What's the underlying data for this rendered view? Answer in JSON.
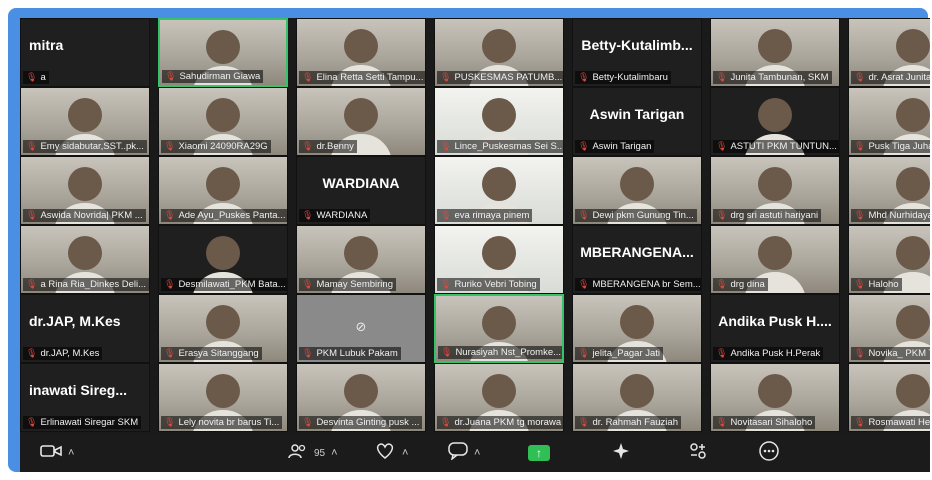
{
  "participants": [
    {
      "display": "mitra",
      "label": "a",
      "kind": "name"
    },
    {
      "display": "",
      "label": "Sahudirman Giawa",
      "kind": "video",
      "active": true
    },
    {
      "display": "",
      "label": "Elina Retta Setti Tampu...",
      "kind": "video"
    },
    {
      "display": "",
      "label": "PUSKESMAS PATUMB...",
      "kind": "video"
    },
    {
      "display": "Betty-Kutalimb...",
      "label": "Betty-Kutalimbaru",
      "kind": "name"
    },
    {
      "display": "",
      "label": "Junita Tambunan, SKM",
      "kind": "video"
    },
    {
      "display": "",
      "label": "dr. Asrat Junita pu",
      "kind": "video"
    },
    {
      "display": "",
      "label": "Emy sidabutar,SST..pk...",
      "kind": "video"
    },
    {
      "display": "",
      "label": "Xiaomi 24090RA29G",
      "kind": "video"
    },
    {
      "display": "",
      "label": "dr.Benny",
      "kind": "video"
    },
    {
      "display": "",
      "label": "Lince_Puskesmas Sei S...",
      "kind": "doc"
    },
    {
      "display": "Aswin Tarigan",
      "label": "Aswin Tarigan",
      "kind": "name"
    },
    {
      "display": "",
      "label": "ASTUTI PKM TUNTUN...",
      "kind": "dark"
    },
    {
      "display": "",
      "label": "Pusk Tiga Juhar_Ti",
      "kind": "video"
    },
    {
      "display": "",
      "label": "Aswida Novrida| PKM ...",
      "kind": "video"
    },
    {
      "display": "",
      "label": "Ade Ayu_Puskes Panta...",
      "kind": "video"
    },
    {
      "display": "WARDIANA",
      "label": "WARDIANA",
      "kind": "name"
    },
    {
      "display": "",
      "label": "eva rimaya pinem",
      "kind": "doc"
    },
    {
      "display": "",
      "label": "Dewi pkm Gunung Tin...",
      "kind": "video"
    },
    {
      "display": "",
      "label": "drg sri astuti hariyani",
      "kind": "video"
    },
    {
      "display": "",
      "label": "Mhd Nurhidayat",
      "kind": "video"
    },
    {
      "display": "",
      "label": "a Rina Ria_Dinkes Deli...",
      "kind": "video"
    },
    {
      "display": "",
      "label": "Desmilawati_PKM Bata...",
      "kind": "dark"
    },
    {
      "display": "",
      "label": "Mamay Sembiring",
      "kind": "video"
    },
    {
      "display": "",
      "label": "Ruriko Vebri Tobing",
      "kind": "doc"
    },
    {
      "display": "MBERANGENA...",
      "label": "MBERANGENA br Sem...",
      "kind": "name"
    },
    {
      "display": "",
      "label": "drg dina",
      "kind": "video"
    },
    {
      "display": "",
      "label": "Haloho",
      "kind": "video"
    },
    {
      "display": "dr.JAP, M.Kes",
      "label": "dr.JAP, M.Kes",
      "kind": "name"
    },
    {
      "display": "",
      "label": "Erasya Sitanggang",
      "kind": "video"
    },
    {
      "display": "",
      "label": "PKM Lubuk Pakam",
      "kind": "gray"
    },
    {
      "display": "",
      "label": "Nurasiyah Nst_Promke...",
      "kind": "video",
      "active": true
    },
    {
      "display": "",
      "label": "jelita_Pagar Jati",
      "kind": "video"
    },
    {
      "display": "Andika Pusk H....",
      "label": "Andika Pusk H.Perak",
      "kind": "name"
    },
    {
      "display": "",
      "label": "Novika_ PKM Tanj",
      "kind": "video"
    },
    {
      "display": "inawati Sireg...",
      "label": "Erlinawati Siregar SKM",
      "kind": "name"
    },
    {
      "display": "",
      "label": "Lely novita br barus Ti...",
      "kind": "video"
    },
    {
      "display": "",
      "label": "Desvinta Ginting pusk ...",
      "kind": "video"
    },
    {
      "display": "",
      "label": "dr.Juana PKM tg morawa",
      "kind": "video"
    },
    {
      "display": "",
      "label": "dr. Rahmah Fauziah",
      "kind": "video"
    },
    {
      "display": "",
      "label": "Novitasari Sihaloho",
      "kind": "video"
    },
    {
      "display": "",
      "label": "Rosmawati Helmi",
      "kind": "video"
    }
  ],
  "toolbar": {
    "participant_count": "95"
  },
  "colors": {
    "frame": "#4a8fe3",
    "muted_icon": "#e0483e",
    "active_border": "#37c26a",
    "share": "#2fbf55"
  }
}
